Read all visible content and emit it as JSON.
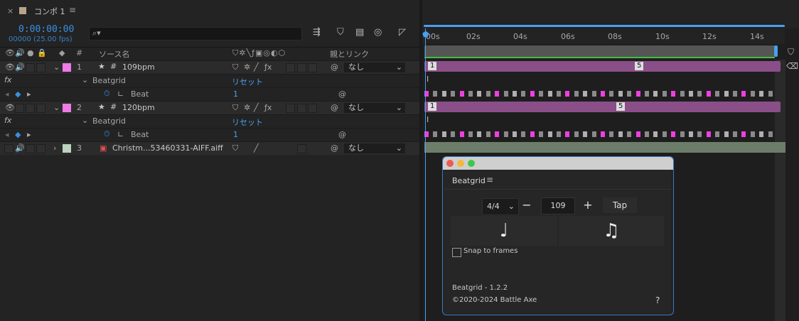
{
  "tab": {
    "close": "×",
    "title": "コンポ 1",
    "menu": "≡"
  },
  "timecode": "0:00:00:00",
  "frames": "00000 (25.00 fps)",
  "search": {
    "placeholder": ""
  },
  "columns": {
    "hash": "#",
    "source_name": "ソース名",
    "parent_link": "親とリンク"
  },
  "layers": [
    {
      "number": "1",
      "name": "109bpm",
      "color": "#f07ae6",
      "parent": "なし"
    },
    {
      "number": "2",
      "name": "120bpm",
      "color": "#f07ae6",
      "parent": "なし"
    },
    {
      "number": "3",
      "name": "Christm...53460331-AIFF.aiff",
      "color": "#bcd3bc",
      "parent": "なし"
    }
  ],
  "effect": {
    "fx": "fx",
    "name": "Beatgrid",
    "reset": "リセット",
    "prop": "Beat",
    "value": "1"
  },
  "ruler": {
    "ticks": [
      "00s",
      "02s",
      "04s",
      "06s",
      "08s",
      "10s",
      "12s",
      "14s"
    ]
  },
  "timeline": {
    "kf1": "1",
    "kf5": "5"
  },
  "colors": {
    "accent": "#4a9fee",
    "layer_bar": "#8a4f88",
    "audio_bar": "#6c7e6a",
    "beat_on": "#f03ee0",
    "work_area_green": "#3fbf3f"
  },
  "panel": {
    "title": "Beatgrid",
    "menu": "≡",
    "time_signature": "4/4",
    "minus": "−",
    "bpm": "109",
    "plus": "+",
    "tap": "Tap",
    "note_quarter": "♩",
    "note_eighths": "♫",
    "snap_label": "Snap to frames",
    "version": "Beatgrid - 1.2.2",
    "copyright": "©2020-2024 Battle Axe",
    "help": "?"
  }
}
